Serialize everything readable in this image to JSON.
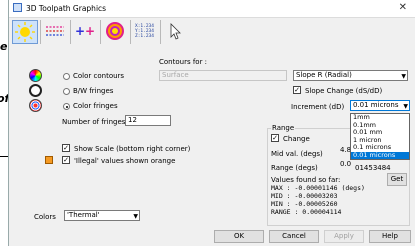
{
  "ghost": {
    "frag1": "e",
    "frag2": "of"
  },
  "window": {
    "title": "3D Toolpath Graphics",
    "close_glyph": "✕"
  },
  "toolbar": {
    "items": [
      {
        "icon": "sun-icon"
      },
      {
        "icon": "dashed-lines-icon"
      },
      {
        "icon": "plus-markers-icon"
      },
      {
        "icon": "color-rings-icon"
      },
      {
        "icon": "coordinates-icon",
        "text": [
          "X:1.234",
          "Y:1.234",
          "Z:1.234"
        ]
      },
      {
        "icon": "cursor-icon"
      }
    ]
  },
  "contours": {
    "heading": "Contours for :",
    "source_value": "Surface",
    "measure_value": "Slope R (Radial)"
  },
  "modes": {
    "color_contours": "Color contours",
    "bw_fringes": "B/W fringes",
    "color_fringes": "Color fringes",
    "selected": "color_fringes"
  },
  "fringes": {
    "label": "Number of fringes",
    "value": "12"
  },
  "slope_change": {
    "label": "Slope Change (dS/dD)",
    "checked": true
  },
  "increment": {
    "label": "Increment (dD)",
    "value": "0.01 microns",
    "options": [
      "1mm",
      "0.1mm",
      "0.01 mm",
      "1 micron",
      "0.1 microns",
      "0.01 microns"
    ],
    "selected_index": 5
  },
  "range": {
    "title": "Range",
    "change_label": "Change",
    "change_checked": true,
    "mid_label": "Mid val. (degs)",
    "mid_value": "4.8",
    "range_label": "Range  (degs)",
    "range_value": "0.0",
    "range_suffix": "01453484",
    "found_label": "Values found so far:",
    "max_line": "MAX   : -0.00001146  (degs)",
    "mid_line": "MID    : -0.00003203",
    "min_line": "MIN    : -0.00005260",
    "range_line": "RANGE : 0.00004114",
    "get_label": "Get"
  },
  "show_scale": {
    "label": "Show Scale (bottom right corner)",
    "checked": true
  },
  "illegal": {
    "label": "'Illegal' values shown orange"
  },
  "colors": {
    "label": "Colors",
    "value": "'Thermal'"
  },
  "buttons": {
    "ok": "OK",
    "cancel": "Cancel",
    "apply": "Apply",
    "help": "Help"
  },
  "palette": {
    "accent": "#0078d7",
    "orange": "#f59a23",
    "titlebar": "#ffffff",
    "dialog": "#f0f0f0"
  }
}
